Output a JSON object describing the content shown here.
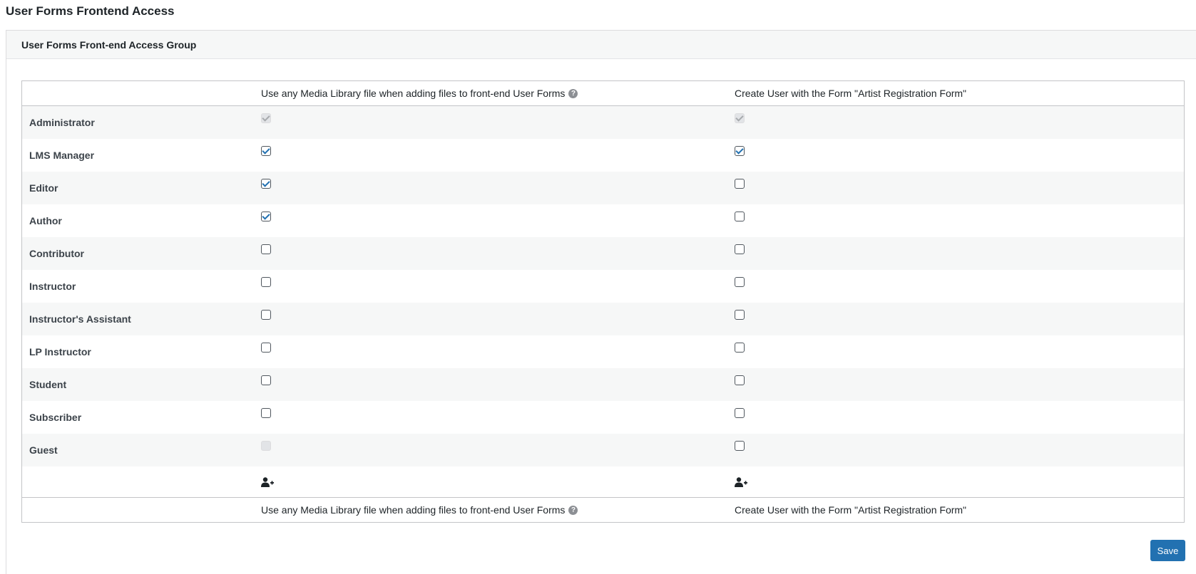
{
  "page": {
    "title": "User Forms Frontend Access"
  },
  "panel": {
    "title": "User Forms Front-end Access Group"
  },
  "columns": [
    {
      "label": "Use any Media Library file when adding files to front-end User Forms",
      "help_icon": "question-circle-icon"
    },
    {
      "label": "Create User with the Form \"Artist Registration Form\""
    }
  ],
  "roles": [
    {
      "name": "Administrator",
      "media": {
        "checked": true,
        "disabled": true
      },
      "create": {
        "checked": true,
        "disabled": true
      }
    },
    {
      "name": "LMS Manager",
      "media": {
        "checked": true,
        "disabled": false
      },
      "create": {
        "checked": true,
        "disabled": false
      }
    },
    {
      "name": "Editor",
      "media": {
        "checked": true,
        "disabled": false
      },
      "create": {
        "checked": false,
        "disabled": false
      }
    },
    {
      "name": "Author",
      "media": {
        "checked": true,
        "disabled": false
      },
      "create": {
        "checked": false,
        "disabled": false
      }
    },
    {
      "name": "Contributor",
      "media": {
        "checked": false,
        "disabled": false
      },
      "create": {
        "checked": false,
        "disabled": false
      }
    },
    {
      "name": "Instructor",
      "media": {
        "checked": false,
        "disabled": false
      },
      "create": {
        "checked": false,
        "disabled": false
      }
    },
    {
      "name": "Instructor's Assistant",
      "media": {
        "checked": false,
        "disabled": false
      },
      "create": {
        "checked": false,
        "disabled": false
      }
    },
    {
      "name": "LP Instructor",
      "media": {
        "checked": false,
        "disabled": false
      },
      "create": {
        "checked": false,
        "disabled": false
      }
    },
    {
      "name": "Student",
      "media": {
        "checked": false,
        "disabled": false
      },
      "create": {
        "checked": false,
        "disabled": false
      }
    },
    {
      "name": "Subscriber",
      "media": {
        "checked": false,
        "disabled": false
      },
      "create": {
        "checked": false,
        "disabled": false
      }
    },
    {
      "name": "Guest",
      "media": {
        "checked": false,
        "disabled": true
      },
      "create": {
        "checked": false,
        "disabled": false
      }
    }
  ],
  "add_user_icon": "user-plus-icon",
  "save_label": "Save",
  "colors": {
    "accent": "#2271b1",
    "stripe": "#f6f7f7",
    "border": "#c3c4c7"
  }
}
